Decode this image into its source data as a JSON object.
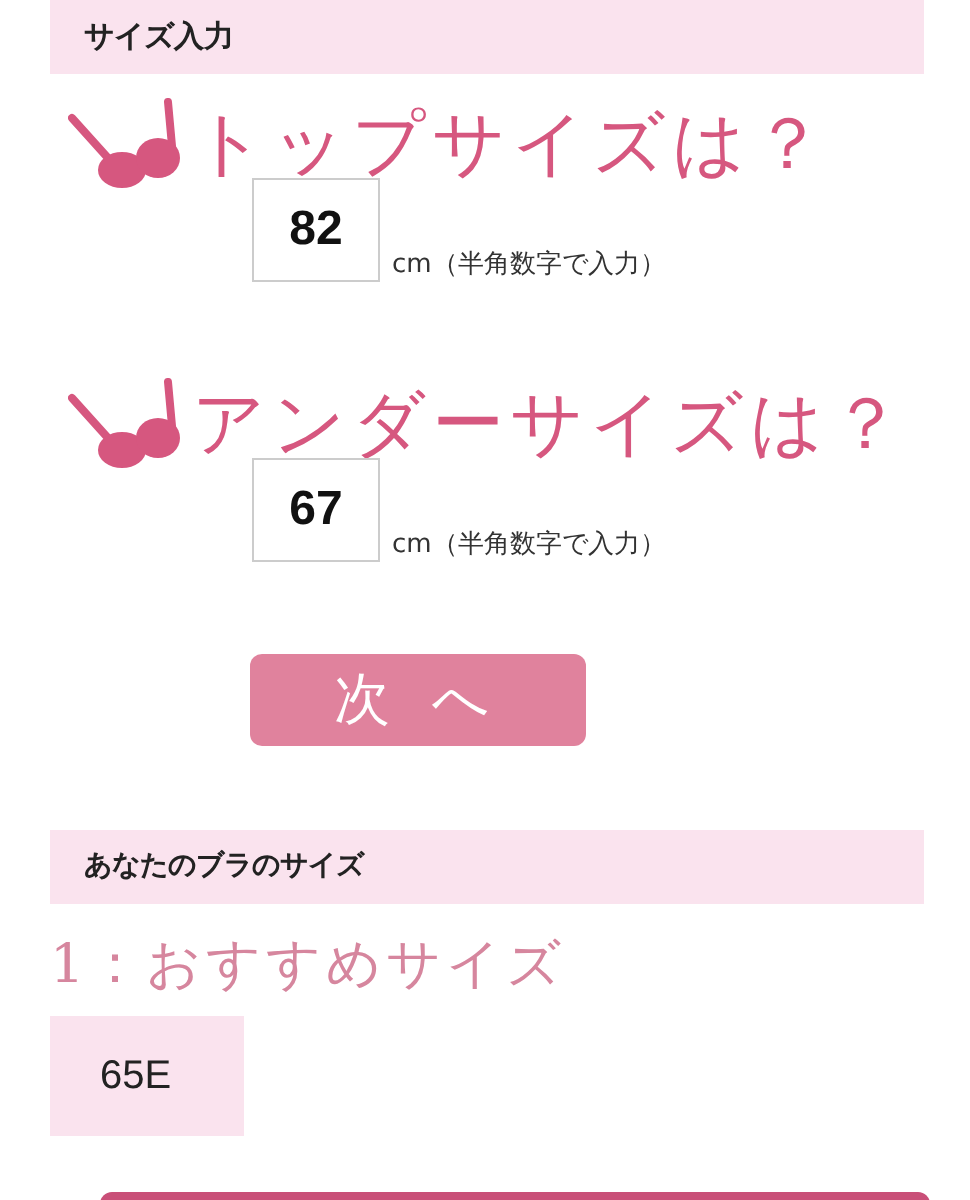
{
  "input_section": {
    "heading": "サイズ入力",
    "questions": [
      {
        "title": "トップサイズは？",
        "value": "82",
        "unit": "cm（半角数字で入力）"
      },
      {
        "title": "アンダーサイズは？",
        "value": "67",
        "unit": "cm（半角数字で入力）"
      }
    ],
    "next_button": "次 へ"
  },
  "result_section": {
    "heading": "あなたのブラのサイズ",
    "label": "1：おすすめサイズ",
    "size": "65E"
  }
}
